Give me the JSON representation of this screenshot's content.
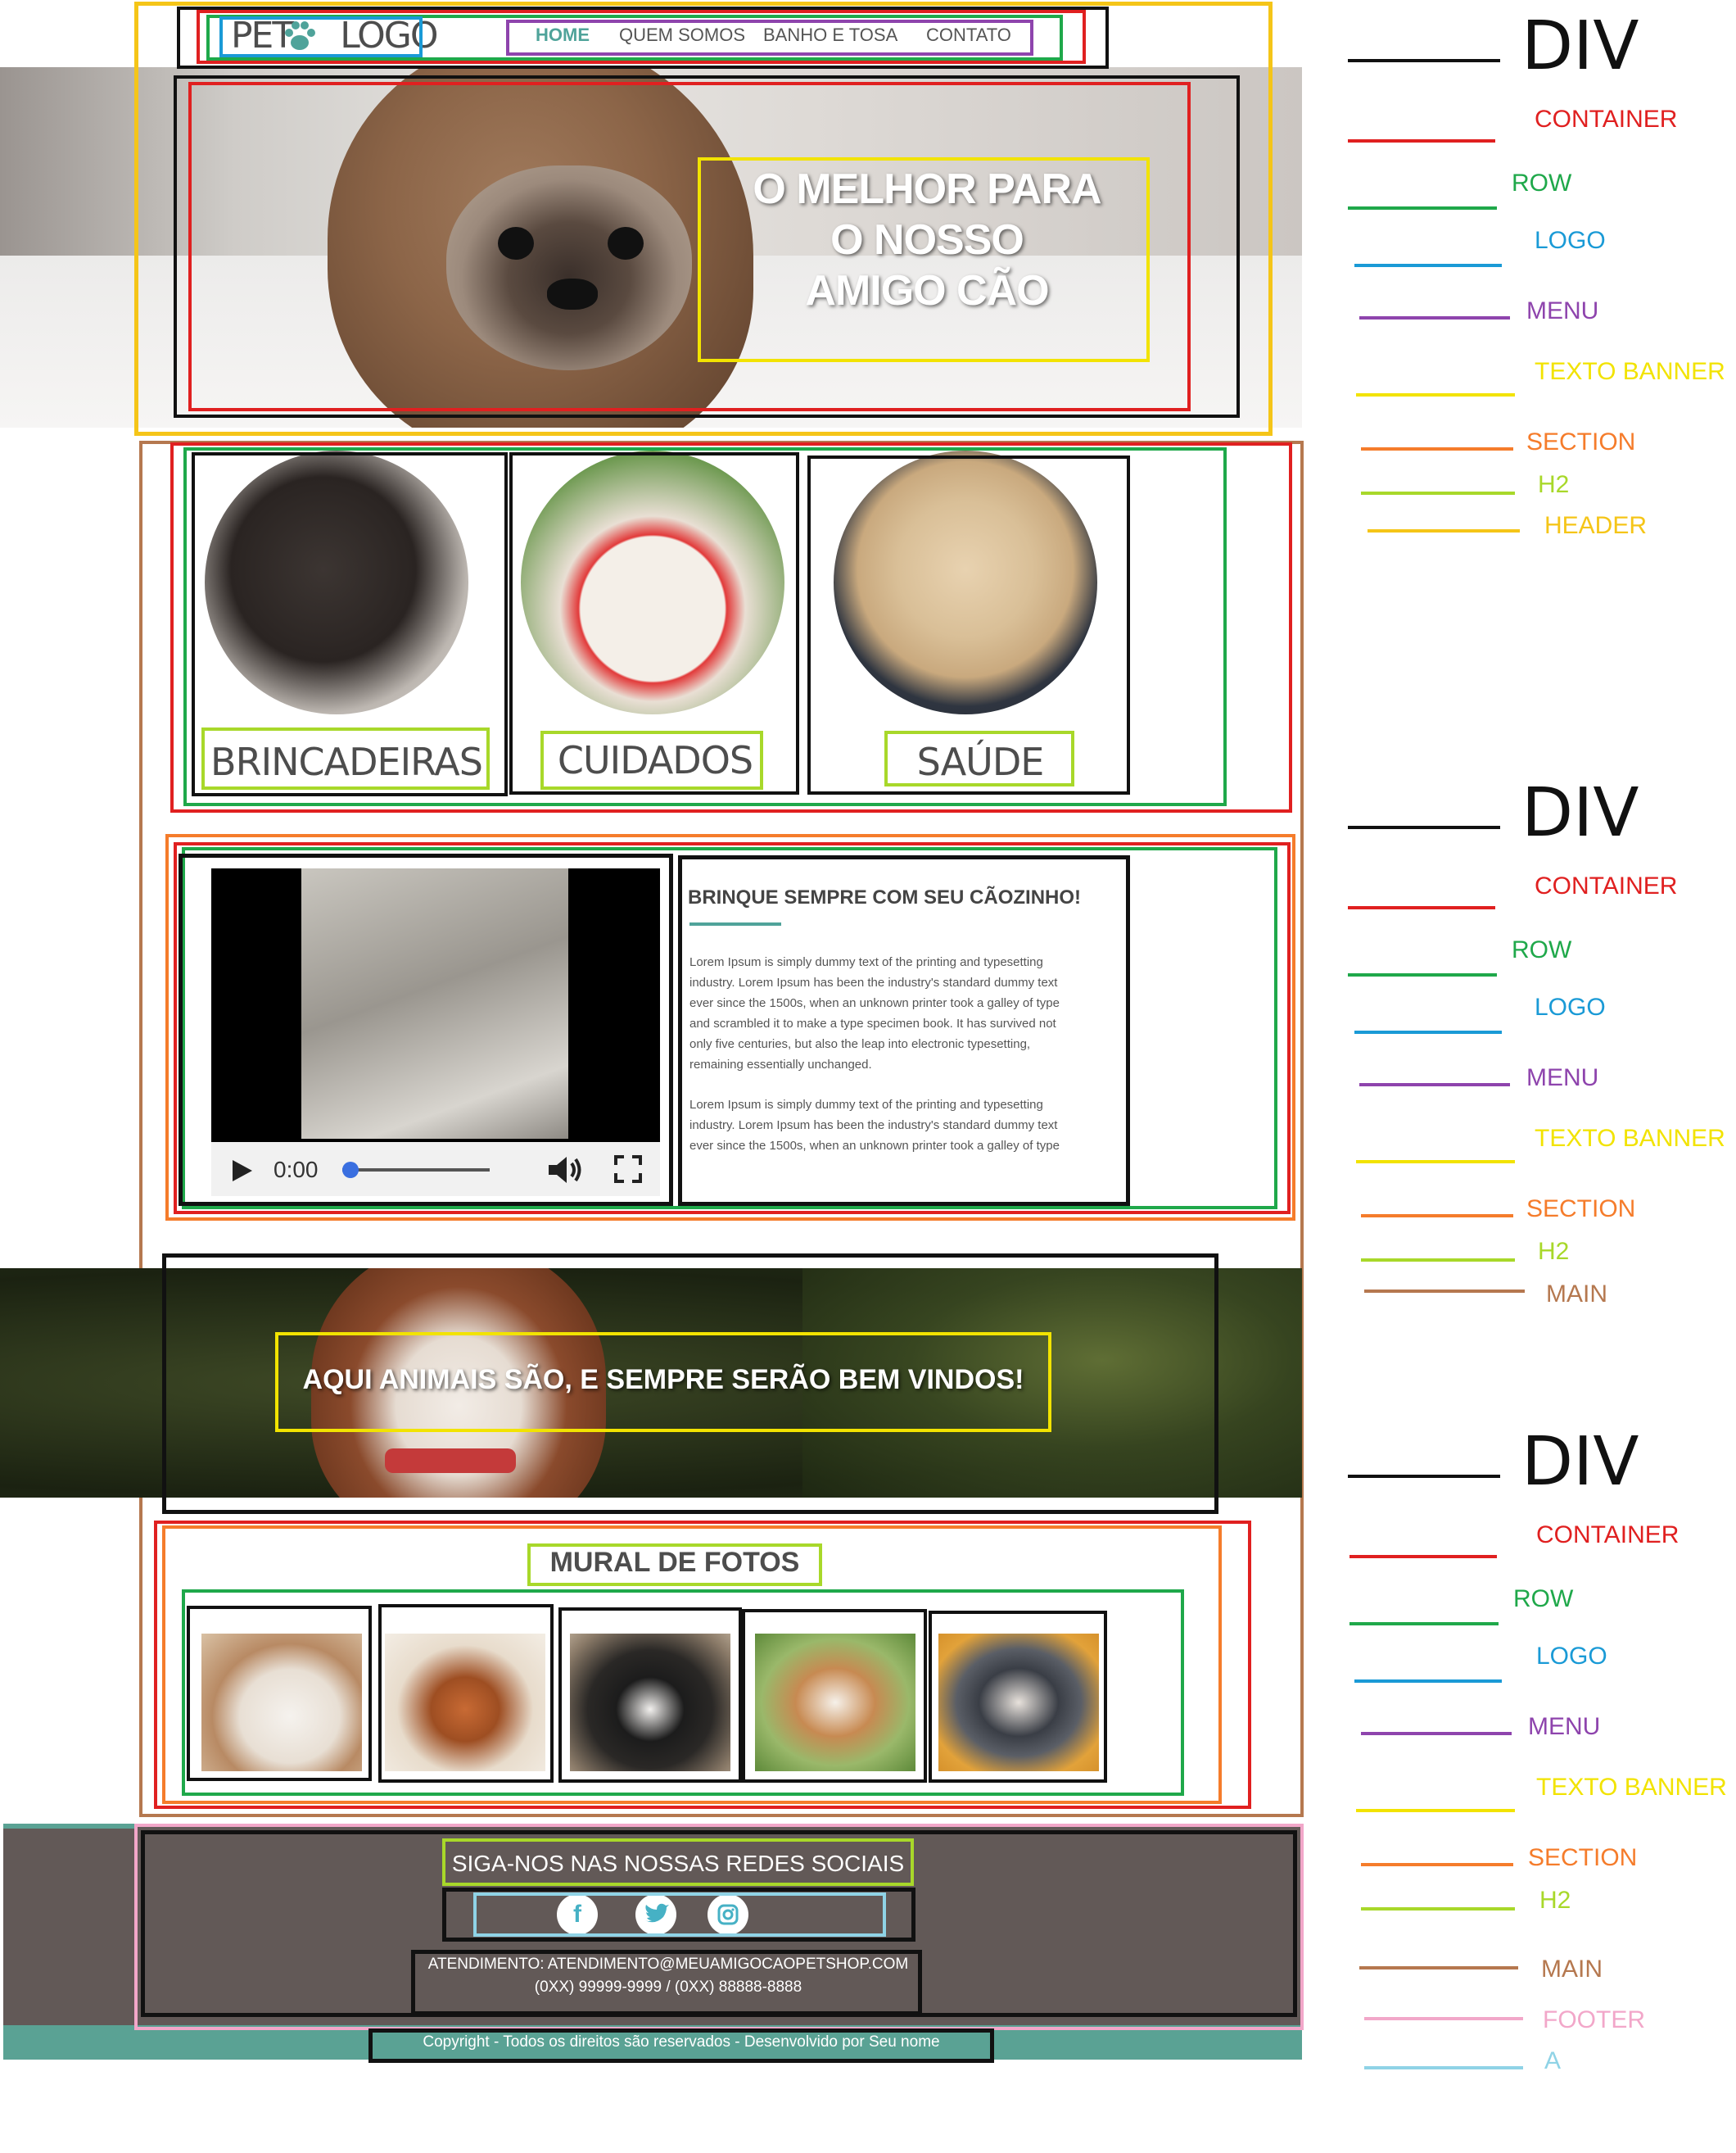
{
  "nav": {
    "logo": "PET",
    "logo_suffix": "LOGO",
    "items": [
      "HOME",
      "QUEM SOMOS",
      "BANHO E TOSA",
      "CONTATO"
    ]
  },
  "hero": {
    "lines": [
      "O MELHOR PARA",
      "O NOSSO",
      "AMIGO CÃO"
    ]
  },
  "cards": [
    "BRINCADEIRAS",
    "CUIDADOS",
    "SAÚDE"
  ],
  "article": {
    "title": "BRINQUE SEMPRE COM SEU CÃOZINHO!",
    "p1": [
      "Lorem Ipsum is simply dummy text of the printing and typesetting",
      "industry. Lorem Ipsum has been the industry's standard dummy text",
      "ever since the 1500s, when an unknown printer took a galley of type",
      "and scrambled it to make a type specimen book. It has survived not",
      "only five centuries, but also the leap into electronic typesetting,",
      "remaining essentially unchanged."
    ],
    "p2": [
      "Lorem Ipsum is simply dummy text of the printing and typesetting",
      "industry. Lorem Ipsum has been the industry's standard dummy text",
      "ever since the 1500s, when an unknown printer took a galley of type"
    ]
  },
  "video": {
    "time": "0:00"
  },
  "banner2": {
    "text": "AQUI ANIMAIS SÃO, E SEMPRE SERÃO BEM VINDOS!"
  },
  "mural": {
    "title": "MURAL DE FOTOS"
  },
  "footer": {
    "title": "SIGA-NOS NAS NOSSAS REDES SOCIAIS",
    "contact_line1": "ATENDIMENTO: ATENDIMENTO@MEUAMIGOCAOPETSHOP.COM",
    "contact_line2": "(0XX) 99999-9999 / (0XX) 88888-8888",
    "copyright": "Copyright - Todos os direitos são reservados - Desenvolvido por Seu nome"
  },
  "social_icons": [
    "facebook-icon",
    "twitter-icon",
    "instagram-icon"
  ],
  "legend_groups": [
    {
      "div_label": "DIV",
      "items": [
        {
          "label": "CONTAINER",
          "color": "#e02020"
        },
        {
          "label": "ROW",
          "color": "#1fa84a"
        },
        {
          "label": "LOGO",
          "color": "#1a9ad6"
        },
        {
          "label": "MENU",
          "color": "#8e44ad"
        },
        {
          "label": "TEXTO BANNER",
          "color": "#f2e300"
        },
        {
          "label": "SECTION",
          "color": "#f57c2b"
        },
        {
          "label": "H2",
          "color": "#a8d82a"
        },
        {
          "label": "HEADER",
          "color": "#f5c518"
        }
      ]
    },
    {
      "div_label": "DIV",
      "items": [
        {
          "label": "CONTAINER",
          "color": "#e02020"
        },
        {
          "label": "ROW",
          "color": "#1fa84a"
        },
        {
          "label": "LOGO",
          "color": "#1a9ad6"
        },
        {
          "label": "MENU",
          "color": "#8e44ad"
        },
        {
          "label": "TEXTO BANNER",
          "color": "#f2e300"
        },
        {
          "label": "SECTION",
          "color": "#f57c2b"
        },
        {
          "label": "H2",
          "color": "#a8d82a"
        },
        {
          "label": "MAIN",
          "color": "#b5784f"
        }
      ]
    },
    {
      "div_label": "DIV",
      "items": [
        {
          "label": "CONTAINER",
          "color": "#e02020"
        },
        {
          "label": "ROW",
          "color": "#1fa84a"
        },
        {
          "label": "LOGO",
          "color": "#1a9ad6"
        },
        {
          "label": "MENU",
          "color": "#8e44ad"
        },
        {
          "label": "TEXTO BANNER",
          "color": "#f2e300"
        },
        {
          "label": "SECTION",
          "color": "#f57c2b"
        },
        {
          "label": "H2",
          "color": "#a8d82a"
        },
        {
          "label": "MAIN",
          "color": "#b5784f"
        },
        {
          "label": "FOOTER",
          "color": "#f2a7c9"
        },
        {
          "label": "A",
          "color": "#8fd3e6"
        }
      ]
    }
  ],
  "colors": {
    "accent": "#4fa39a",
    "footer_bg": "#625957",
    "footer_strip": "#5aa294",
    "text_dark": "#4d4d4d"
  }
}
